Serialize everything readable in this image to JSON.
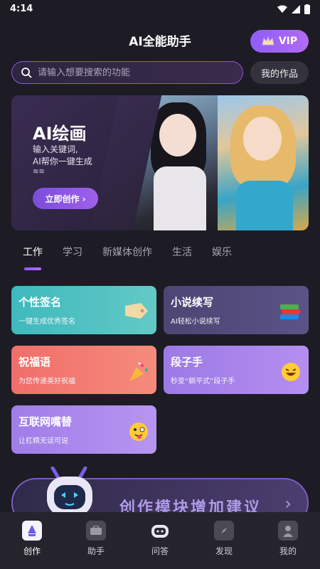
{
  "status": {
    "time": "4:14"
  },
  "header": {
    "title": "AI全能助手",
    "vip_label": "VIP"
  },
  "search": {
    "placeholder": "请输入想要搜索的功能",
    "my_works": "我的作品"
  },
  "banner": {
    "title": "AI绘画",
    "subtitle_line1": "输入关键词,",
    "subtitle_line2": "AI帮你一键生成",
    "button": "立即创作 ›"
  },
  "tabs": [
    "工作",
    "学习",
    "新媒体创作",
    "生活",
    "娱乐"
  ],
  "cards": [
    {
      "title": "个性签名",
      "sub": "一键生成优秀签名",
      "icon": "tag-icon"
    },
    {
      "title": "小说续写",
      "sub": "AI轻松小说续写",
      "icon": "books-icon"
    },
    {
      "title": "祝福语",
      "sub": "为您传递美好祝福",
      "icon": "party-popper-icon"
    },
    {
      "title": "段子手",
      "sub": "秒变“躺平式”段子手",
      "icon": "laughing-face-icon"
    },
    {
      "title": "互联网嘴替",
      "sub": "让杠精无话可说",
      "icon": "tongue-face-icon"
    }
  ],
  "suggest": {
    "text": "创作模块增加建议",
    "arrow": "›"
  },
  "nav": [
    "创作",
    "助手",
    "问答",
    "发现",
    "我的"
  ]
}
